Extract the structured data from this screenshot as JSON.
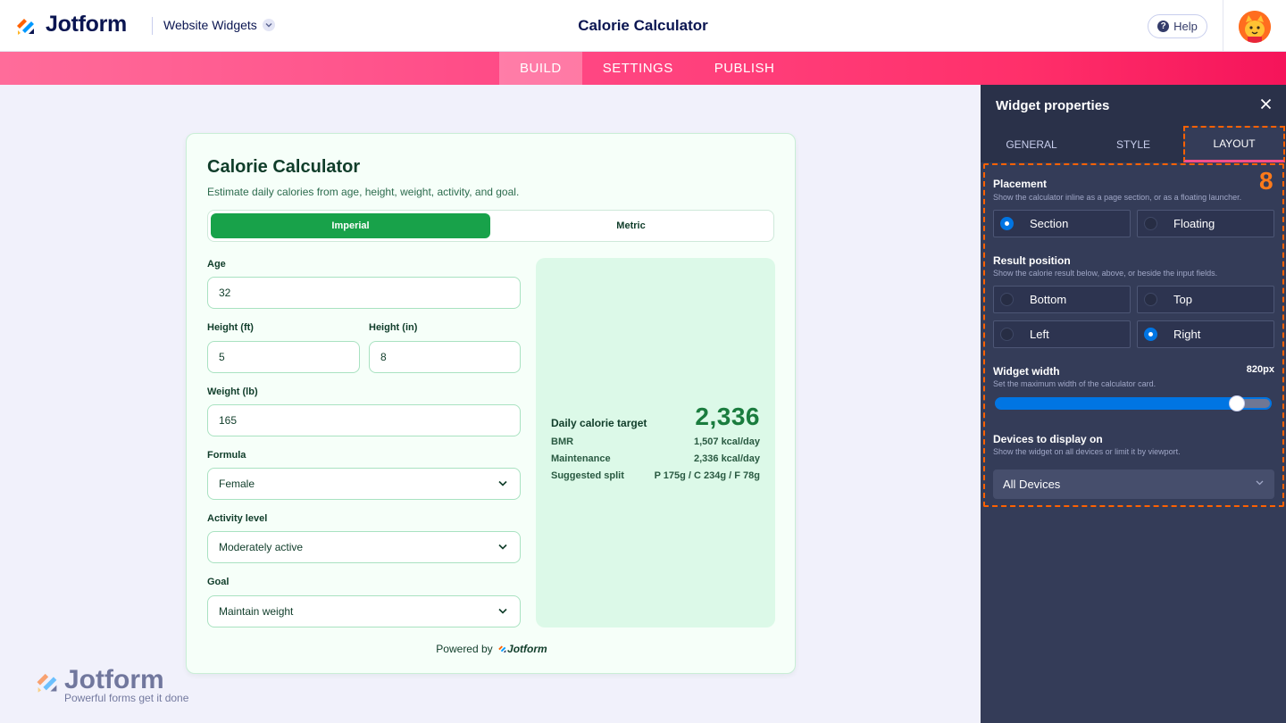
{
  "topbar": {
    "logo_text": "Jotform",
    "section_menu": "Website Widgets",
    "title": "Calorie Calculator",
    "help_label": "Help"
  },
  "nav": {
    "tabs": [
      {
        "label": "BUILD",
        "active": true
      },
      {
        "label": "SETTINGS",
        "active": false
      },
      {
        "label": "PUBLISH",
        "active": false
      }
    ]
  },
  "calculator": {
    "title": "Calorie Calculator",
    "subtitle": "Estimate daily calories from age, height, weight, activity, and goal.",
    "units": {
      "imperial": "Imperial",
      "metric": "Metric",
      "selected": "Imperial"
    },
    "fields": {
      "age": {
        "label": "Age",
        "value": "32"
      },
      "height_ft": {
        "label": "Height (ft)",
        "value": "5"
      },
      "height_in": {
        "label": "Height (in)",
        "value": "8"
      },
      "weight": {
        "label": "Weight (lb)",
        "value": "165"
      },
      "formula": {
        "label": "Formula",
        "value": "Female"
      },
      "activity": {
        "label": "Activity level",
        "value": "Moderately active"
      },
      "goal": {
        "label": "Goal",
        "value": "Maintain weight"
      }
    },
    "result": {
      "title": "Daily calorie target",
      "value": "2,336",
      "rows": [
        {
          "label": "BMR",
          "value": "1,507 kcal/day"
        },
        {
          "label": "Maintenance",
          "value": "2,336 kcal/day"
        },
        {
          "label": "Suggested split",
          "value": "P 175g / C 234g / F 78g"
        }
      ]
    },
    "powered_prefix": "Powered by",
    "powered_brand": "Jotform"
  },
  "watermark": {
    "brand": "Jotform",
    "tagline": "Powerful forms get it done"
  },
  "panel": {
    "title": "Widget properties",
    "tabs": [
      {
        "label": "GENERAL",
        "active": false
      },
      {
        "label": "STYLE",
        "active": false
      },
      {
        "label": "LAYOUT",
        "active": true
      }
    ],
    "badge": "8",
    "placement": {
      "title": "Placement",
      "desc": "Show the calculator inline as a page section, or as a floating launcher.",
      "options": [
        "Section",
        "Floating"
      ],
      "selected": "Section"
    },
    "result_position": {
      "title": "Result position",
      "desc": "Show the calorie result below, above, or beside the input fields.",
      "options": [
        "Bottom",
        "Top",
        "Left",
        "Right"
      ],
      "selected": "Right"
    },
    "width": {
      "title": "Widget width",
      "value_label": "820px",
      "desc": "Set the maximum width of the calculator card.",
      "slider_fraction": 0.88
    },
    "devices": {
      "title": "Devices to display on",
      "desc": "Show the widget on all devices or limit it by viewport.",
      "value": "All Devices"
    }
  },
  "colors": {
    "accent_pink": "#ff4a86",
    "green_primary": "#18a24a",
    "panel_bg": "#343c58",
    "radio_blue": "#0075e3",
    "highlight_orange": "#ff6100"
  }
}
